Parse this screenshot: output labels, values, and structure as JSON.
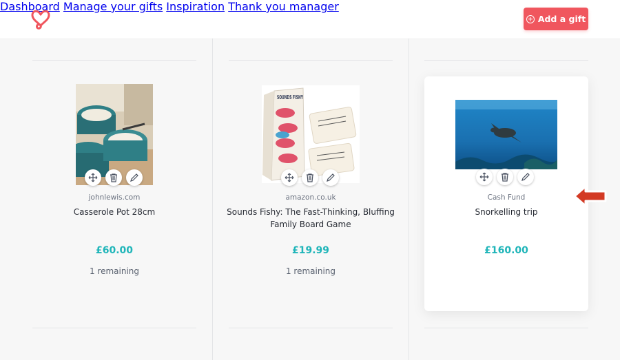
{
  "header": {
    "nav": [
      "Dashboard",
      "Manage your gifts",
      "Inspiration",
      "Thank you manager"
    ],
    "add_button": "Add a gift",
    "logo_color": "#f0565e"
  },
  "gifts": [
    {
      "source": "johnlewis.com",
      "title": "Casserole Pot 28cm",
      "price": "£60.00",
      "remaining": "1 remaining"
    },
    {
      "source": "amazon.co.uk",
      "title": "Sounds Fishy: The Fast-Thinking, Bluffing Family Board Game",
      "price": "£19.99",
      "remaining": "1 remaining"
    },
    {
      "source": "Cash Fund",
      "title": "Snorkelling trip",
      "price": "£160.00"
    }
  ],
  "game_box_text": "SOUNDS FISHY",
  "icons": [
    "heart-logo-icon",
    "plus-circle-icon",
    "move-icon",
    "trash-icon",
    "edit-pencil-icon",
    "arrow-pointer-icon"
  ],
  "colors": {
    "accent": "#f0565e",
    "price": "#1fb5b9"
  }
}
